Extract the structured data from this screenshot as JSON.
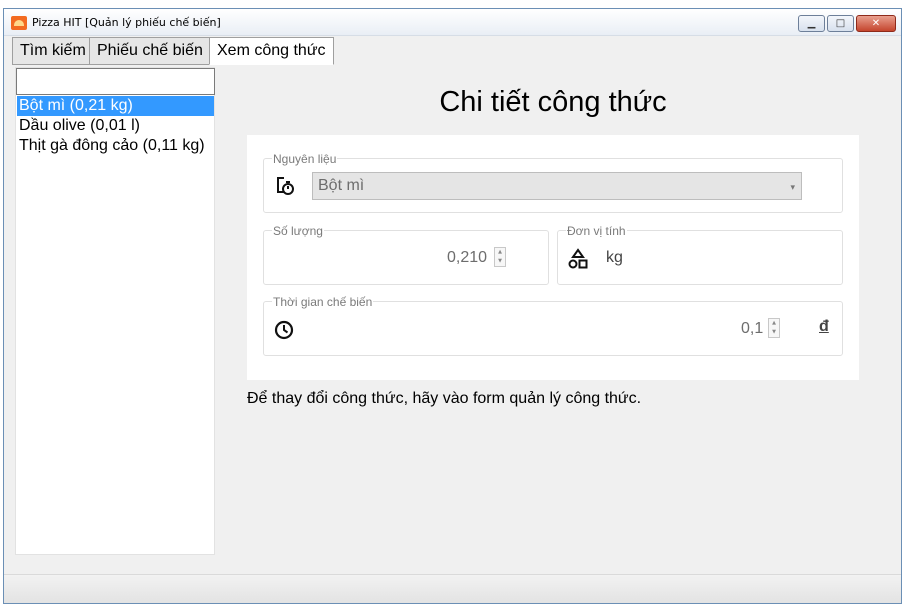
{
  "window": {
    "title": "Pizza HIT [Quản lý phiếu chế biến]",
    "minimize_glyph": "▁",
    "maximize_glyph": "□",
    "close_glyph": "✕"
  },
  "tabs": [
    {
      "label": "Tìm kiếm"
    },
    {
      "label": "Phiếu chế biến"
    },
    {
      "label": "Xem công thức"
    }
  ],
  "active_tab": "Xem công thức",
  "sidebar": {
    "search_value": "",
    "items": [
      {
        "label": "Bột mì (0,21 kg)",
        "selected": true
      },
      {
        "label": "Dầu olive (0,01 l)",
        "selected": false
      },
      {
        "label": "Thịt gà đông cảo (0,11 kg)",
        "selected": false
      }
    ]
  },
  "detail": {
    "heading": "Chi tiết công thức",
    "ingredient_label": "Nguyên liệu",
    "ingredient_value": "Bột mì",
    "quantity_label": "Số lượng",
    "quantity_value": "0,210",
    "unit_label": "Đơn vị tính",
    "unit_value": "kg",
    "time_label": "Thời gian chế biến",
    "time_value": "0,1",
    "time_unit": "đ"
  },
  "note": "Để thay đổi công thức, hãy vào form quản lý công thức.",
  "icons": {
    "ingredient": "ingredient-timer-icon",
    "unit": "shapes-icon",
    "time": "clock-icon",
    "dropdown": "chevron-down-icon"
  },
  "colors": {
    "selection": "#3399ff",
    "window_bg": "#f0f0f0",
    "close_button": "#c4452d"
  }
}
